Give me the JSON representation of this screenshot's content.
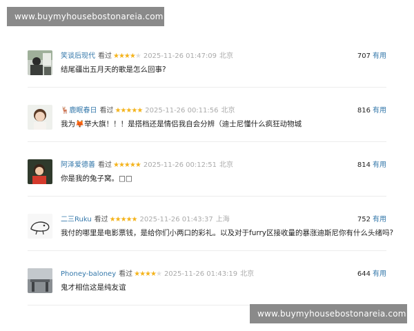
{
  "watermark": {
    "top": "www.buymyhousebostonareia.com",
    "bottom": "www.buymyhousebostonareia.com"
  },
  "colors": {
    "link": "#3377aa",
    "star": "#f4b31b",
    "meta": "#aaaaaa",
    "watermark_bg": "#8a8a8a"
  },
  "reviews": [
    {
      "user": "笑谈后现代",
      "status": "看过",
      "stars": "★★★★",
      "stars_off": "★",
      "rating": 4,
      "time": "2025-11-26 01:47:09",
      "location": "北京",
      "count": "707",
      "useful": "有用",
      "text": "结尾疆出五月天的歌是怎么回事?"
    },
    {
      "user": "🦌鹿眠春日",
      "status": "看过",
      "stars": "★★★★★",
      "stars_off": "",
      "rating": 5,
      "time": "2025-11-26 00:11:56",
      "location": "北京",
      "count": "816",
      "useful": "有用",
      "text": "我为🦊举大旗！！！是搭档还是情侣我自会分辨（迪士尼懂什么疯狂动物城"
    },
    {
      "user": "阿泽爱德善",
      "status": "看过",
      "stars": "★★★★★",
      "stars_off": "",
      "rating": 5,
      "time": "2025-11-26 00:12:51",
      "location": "北京",
      "count": "814",
      "useful": "有用",
      "text": "你是我的兔子窝。□□"
    },
    {
      "user": "二三Ruku",
      "status": "看过",
      "stars": "★★★★★",
      "stars_off": "",
      "rating": 5,
      "time": "2025-11-26 01:43:37",
      "location": "上海",
      "count": "752",
      "useful": "有用",
      "text": "我付的哪里是电影票钱，是给你们小两口的彩礼。以及对于furry区接收量的暴涨迪斯尼你有什么头绪吗?"
    },
    {
      "user": "Phoney-baloney",
      "status": "看过",
      "stars": "★★★★",
      "stars_off": "★",
      "rating": 4,
      "time": "2025-11-26 01:43:19",
      "location": "北京",
      "count": "644",
      "useful": "有用",
      "text": "鬼才相信这是纯友谊"
    }
  ]
}
